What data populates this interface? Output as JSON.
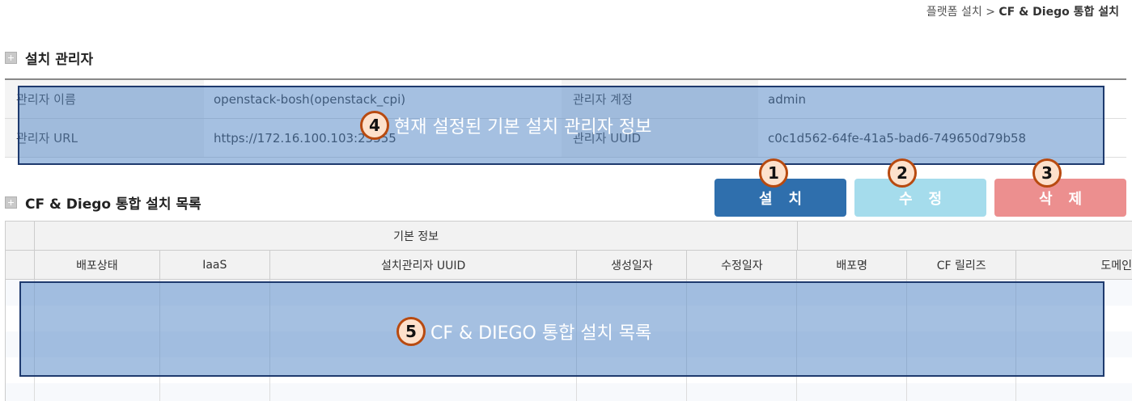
{
  "breadcrumb": {
    "parent": "플랫폼 설치",
    "separator": ">",
    "current": "CF & Diego 통합 설치"
  },
  "manager_section": {
    "title": "설치 관리자",
    "rows": [
      {
        "k1": "관리자 이름",
        "v1": "openstack-bosh(openstack_cpi)",
        "k2": "관리자 계정",
        "v2": "admin"
      },
      {
        "k1": "관리자 URL",
        "v1": "https://172.16.100.103:25555",
        "k2": "관리자 UUID",
        "v2": "c0c1d562-64fe-41a5-bad6-749650d79b58"
      }
    ]
  },
  "list_section": {
    "title": "CF & Diego 통합 설치 목록"
  },
  "buttons": {
    "install": "설치",
    "edit": "수정",
    "delete": "삭제"
  },
  "annotations": {
    "a1": "1",
    "a2": "2",
    "a3": "3",
    "a4": {
      "num": "4",
      "text": "현재 설정된 기본 설치 관리자 정보"
    },
    "a5": {
      "num": "5",
      "text": "CF & DIEGO 통합 설치 목록"
    }
  },
  "table": {
    "group_header": "기본 정보",
    "columns": [
      "배포상태",
      "IaaS",
      "설치관리자 UUID",
      "생성일자",
      "수정일자",
      "배포명",
      "CF 릴리즈",
      "도메인"
    ]
  },
  "colors": {
    "install": "#2f6fad",
    "edit": "#a5dcec",
    "delete": "#ec8f8f",
    "overlay": "#4c82c4"
  }
}
